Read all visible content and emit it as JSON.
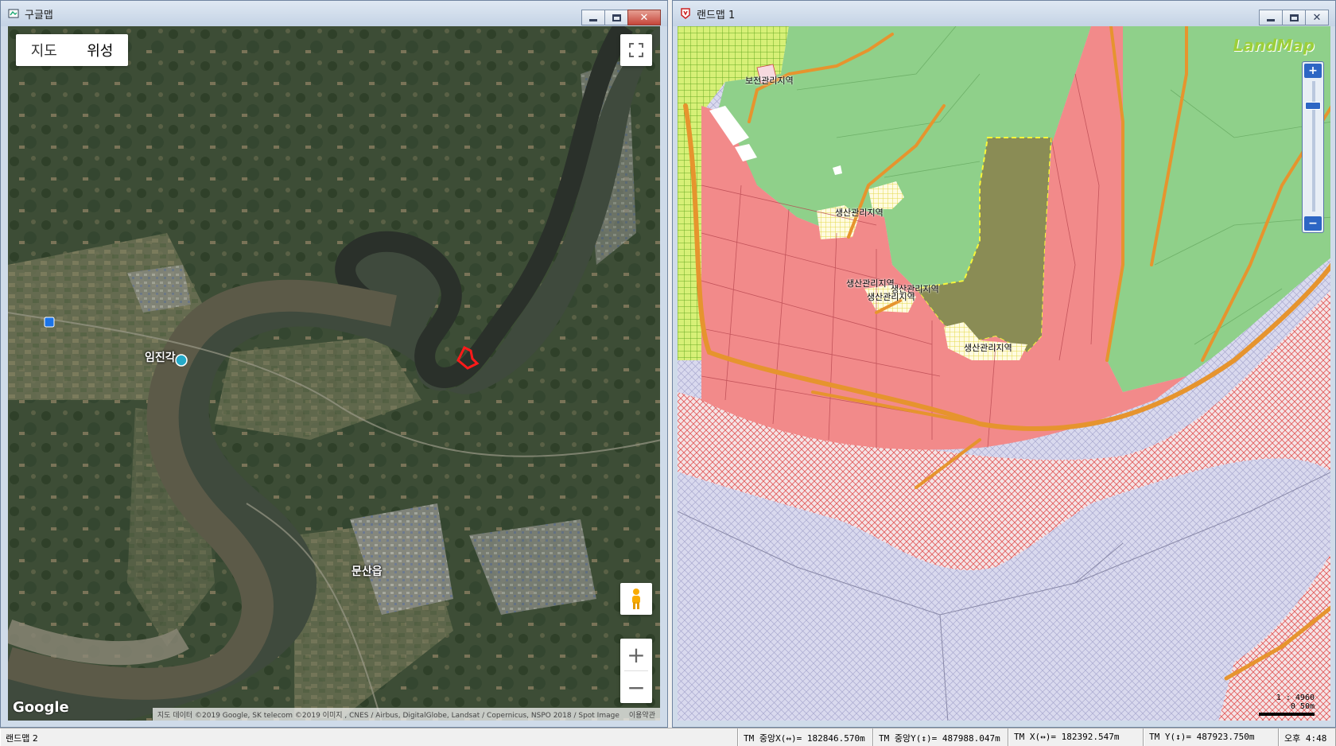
{
  "left_window": {
    "title": "구글맵",
    "map_type": {
      "map_label": "지도",
      "satellite_label": "위성",
      "selected": "위성"
    },
    "places": {
      "imjingak": "임진각",
      "munsan": "문산읍"
    },
    "logo": "Google",
    "attribution": "지도 데이터 ©2019 Google, SK telecom ©2019 이미지 , CNES / Airbus, DigitalGlobe, Landsat / Copernicus, NSPO 2018 / Spot Image",
    "terms": "이용약관",
    "zoom_in": "+",
    "zoom_out": "−"
  },
  "right_window": {
    "title": "랜드맵 1",
    "logo": "LandMap",
    "zone_labels": {
      "preservation": "보전관리지역",
      "production_a": "생산관리지역",
      "production_b": "생산관리지역",
      "production_c": "생산관리지역",
      "production_d": "생산관리지역",
      "production_e": "생산관리지역"
    },
    "scale_ratio": "1 : 4960",
    "scale_dist": "0   50m",
    "zoom_in": "+",
    "zoom_out": "−"
  },
  "statusbar": {
    "app": "랜드맵 2",
    "tm_center_x": "TM 중앙X(↔)= 182846.570m",
    "tm_center_y": "TM 중앙Y(↕)= 487988.047m",
    "tm_x": "TM X(↔)= 182392.547m",
    "tm_y": "TM Y(↕)= 487923.750m",
    "clock": "오후 4:48"
  },
  "colors": {
    "title_bg": "#c4d3e5",
    "close_red": "#c6463a",
    "zone_pink": "#f28a8a",
    "zone_green": "#8fd08a",
    "zone_olive": "#8a8c55",
    "water_lavender": "#d9d9ee",
    "road_orange": "#e6942e"
  }
}
